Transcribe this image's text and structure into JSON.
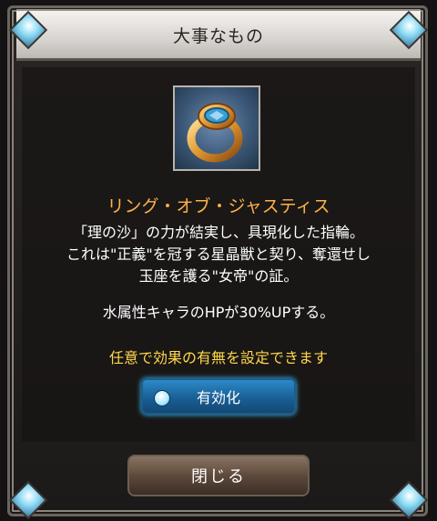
{
  "dialog": {
    "title": "大事なもの"
  },
  "item": {
    "icon": "ring-icon",
    "name": "リング・オブ・ジャスティス",
    "description_lines": [
      "「理の沙」の力が結実し、具現化した指輪。",
      "これは\"正義\"を冠する星晶獣と契り、奪還せし",
      "玉座を護る\"女帝\"の証。"
    ],
    "effect": "水属性キャラのHPが30%UPする。",
    "note": "任意で効果の有無を設定できます"
  },
  "toggle": {
    "label": "有効化",
    "enabled": true
  },
  "close_button": {
    "label": "閉じる"
  },
  "colors": {
    "item_name": "#ffb347",
    "note": "#ffd84a",
    "toggle": "#1a5f95"
  }
}
